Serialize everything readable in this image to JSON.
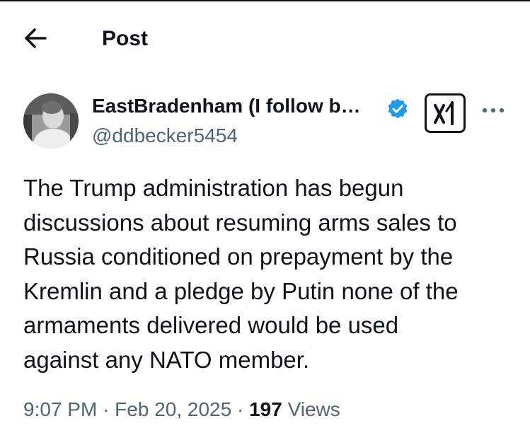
{
  "header": {
    "back_icon": "arrow-left-icon",
    "title": "Post"
  },
  "author": {
    "display_name": "EastBradenham (I follow b…",
    "handle": "@ddbecker5454",
    "verified_icon": "verified-badge-icon",
    "verified_color": "#1d9bf0",
    "grok_icon": "grok-logo-icon",
    "more_icon": "more-horizontal-icon"
  },
  "tweet": {
    "text": "The Trump administration has begun\ndiscussions about resuming arms sales to\nRussia conditioned on prepayment by the\nKremlin and a pledge by Putin none of the\narmaments delivered would be used\nagainst any NATO member."
  },
  "meta": {
    "time": "9:07 PM",
    "separator": "·",
    "date": "Feb 20, 2025",
    "views_count": "197",
    "views_label": "Views"
  },
  "colors": {
    "text_primary": "#0f1419",
    "text_secondary": "#536471",
    "accent": "#1d9bf0"
  }
}
